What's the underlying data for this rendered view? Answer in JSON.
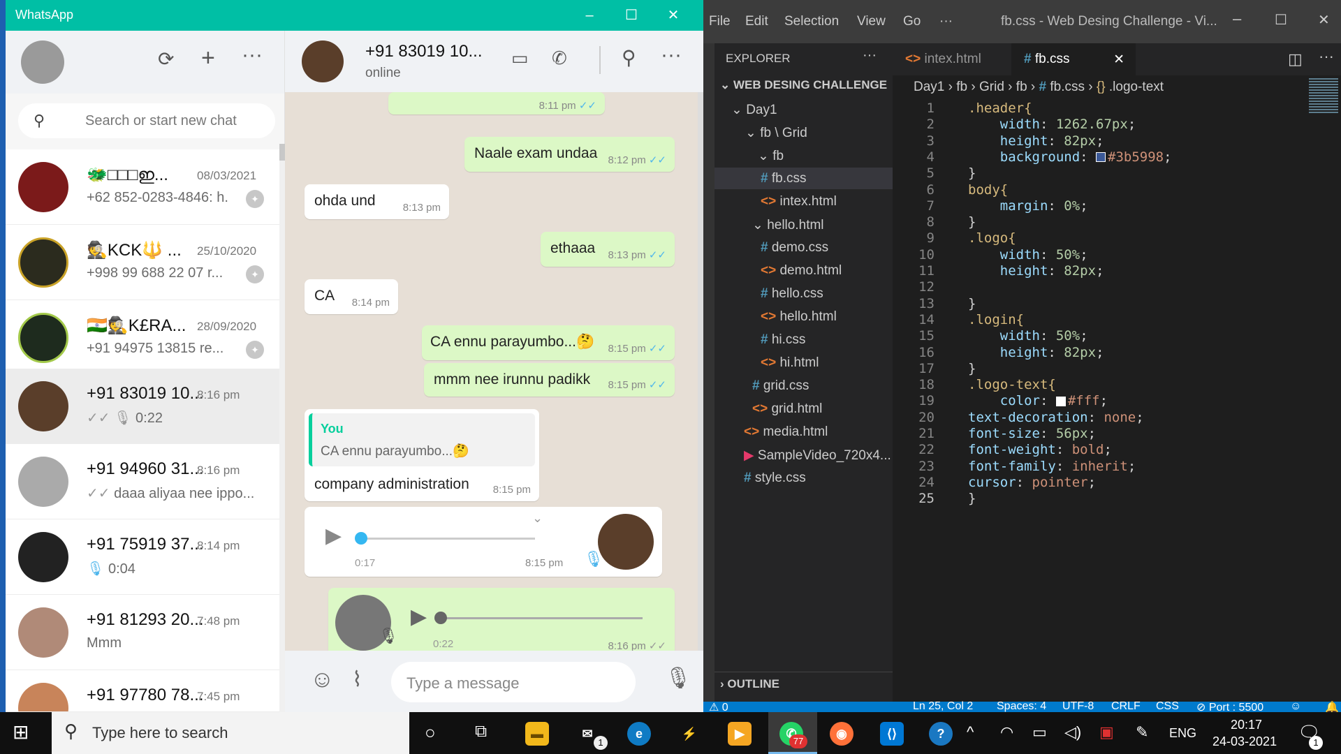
{
  "whatsapp": {
    "window_title": "WhatsApp",
    "window_buttons": [
      "–",
      "☐",
      "✕"
    ],
    "search_placeholder": "Search or start new chat",
    "chats": [
      {
        "name": "🐲□□□ഇ...",
        "time": "08/03/2021",
        "preview": "+62 852-0283-4846: h."
      },
      {
        "name": "🕵KCK🔱 ...",
        "time": "25/10/2020",
        "preview": "+998 99 688 22 07 r..."
      },
      {
        "name": "🇮🇳🕵K£RA...",
        "time": "28/09/2020",
        "preview": "+91 94975 13815 re..."
      },
      {
        "name": "+91 83019 10...",
        "time": "8:16 pm",
        "preview": "0:22"
      },
      {
        "name": "+91 94960 31...",
        "time": "8:16 pm",
        "preview": "daaa aliyaa nee ippo..."
      },
      {
        "name": "+91 75919 37...",
        "time": "8:14 pm",
        "preview": "0:04"
      },
      {
        "name": "+91 81293 20...",
        "time": "7:48 pm",
        "preview": "Mmm"
      },
      {
        "name": "+91 97780 78...",
        "time": "7:45 pm",
        "preview": ""
      }
    ],
    "contact": {
      "name": "+91 83019 10...",
      "status": "online"
    },
    "messages": {
      "m0_time": "8:11 pm",
      "m1_text": "Naale exam undaa",
      "m1_time": "8:12 pm",
      "m2_text": "ohda und",
      "m2_time": "8:13 pm",
      "m3_text": "ethaaa",
      "m3_time": "8:13 pm",
      "m4_text": "CA",
      "m4_time": "8:14 pm",
      "m5_text": "CA ennu parayumbo...🤔",
      "m5_time": "8:15 pm",
      "m6_text": "mmm nee irunnu padikk",
      "m6_time": "8:15 pm",
      "m7_quote_author": "You",
      "m7_quote_text": "CA ennu parayumbo...🤔",
      "m7_text": "company administration",
      "m7_time": "8:15 pm",
      "m8_duration": "0:17",
      "m8_time": "8:15 pm",
      "m9_duration": "0:22",
      "m9_time": "8:16 pm"
    },
    "composer_placeholder": "Type a message"
  },
  "vscode": {
    "menu": [
      "File",
      "Edit",
      "Selection",
      "View",
      "Go",
      "···"
    ],
    "window_title": "fb.css - Web Desing Challenge - Vi...",
    "explorer_title": "EXPLORER",
    "workspace": "WEB DESING CHALLENGE",
    "tree": [
      {
        "label": "Day1",
        "kind": "folder"
      },
      {
        "label": "fb \\ Grid",
        "kind": "folder"
      },
      {
        "label": "fb",
        "kind": "folder"
      },
      {
        "label": "fb.css",
        "kind": "css"
      },
      {
        "label": "intex.html",
        "kind": "html"
      },
      {
        "label": "hello.html",
        "kind": "folder"
      },
      {
        "label": "demo.css",
        "kind": "css"
      },
      {
        "label": "demo.html",
        "kind": "html"
      },
      {
        "label": "hello.css",
        "kind": "css"
      },
      {
        "label": "hello.html",
        "kind": "html"
      },
      {
        "label": "hi.css",
        "kind": "css"
      },
      {
        "label": "hi.html",
        "kind": "html"
      },
      {
        "label": "grid.css",
        "kind": "css"
      },
      {
        "label": "grid.html",
        "kind": "html"
      },
      {
        "label": "media.html",
        "kind": "html"
      },
      {
        "label": "SampleVideo_720x4...",
        "kind": "video"
      },
      {
        "label": "style.css",
        "kind": "css"
      }
    ],
    "outline": "OUTLINE",
    "tabs": [
      {
        "label": "intex.html"
      },
      {
        "label": "fb.css"
      }
    ],
    "breadcrumb": [
      "Day1",
      "fb",
      "Grid",
      "fb",
      "fb.css",
      ".logo-text"
    ],
    "code_lines": [
      ".header{",
      "    width: 1262.67px;",
      "    height: 82px;",
      "    background: #3b5998;",
      "}",
      "body{",
      "    margin: 0%;",
      "}",
      ".logo{",
      "    width: 50%;",
      "    height: 82px;",
      "",
      "}",
      ".login{",
      "    width: 50%;",
      "    height: 82px;",
      "}",
      ".logo-text{",
      "    color: #fff;",
      "text-decoration: none;",
      "font-size: 56px;",
      "font-weight: bold;",
      "font-family: inherit;",
      "cursor: pointer;",
      "}"
    ],
    "status": {
      "problems": "⚠ 0",
      "position": "Ln 25, Col 2",
      "spaces": "Spaces: 4",
      "encoding": "UTF-8",
      "eol": "CRLF",
      "language": "CSS",
      "port": "Port : 5500"
    }
  },
  "taskbar": {
    "search_placeholder": "Type here to search",
    "whatsapp_badge": "77",
    "mail_badge": "1",
    "language": "ENG",
    "time": "20:17",
    "date": "24-03-2021",
    "notification_count": "1"
  },
  "colors": {
    "whatsapp_green": "#00bfa5",
    "bubble_out": "#dcf8c6",
    "vscode_blue": "#007acc",
    "header_swatch": "#3b5998"
  }
}
